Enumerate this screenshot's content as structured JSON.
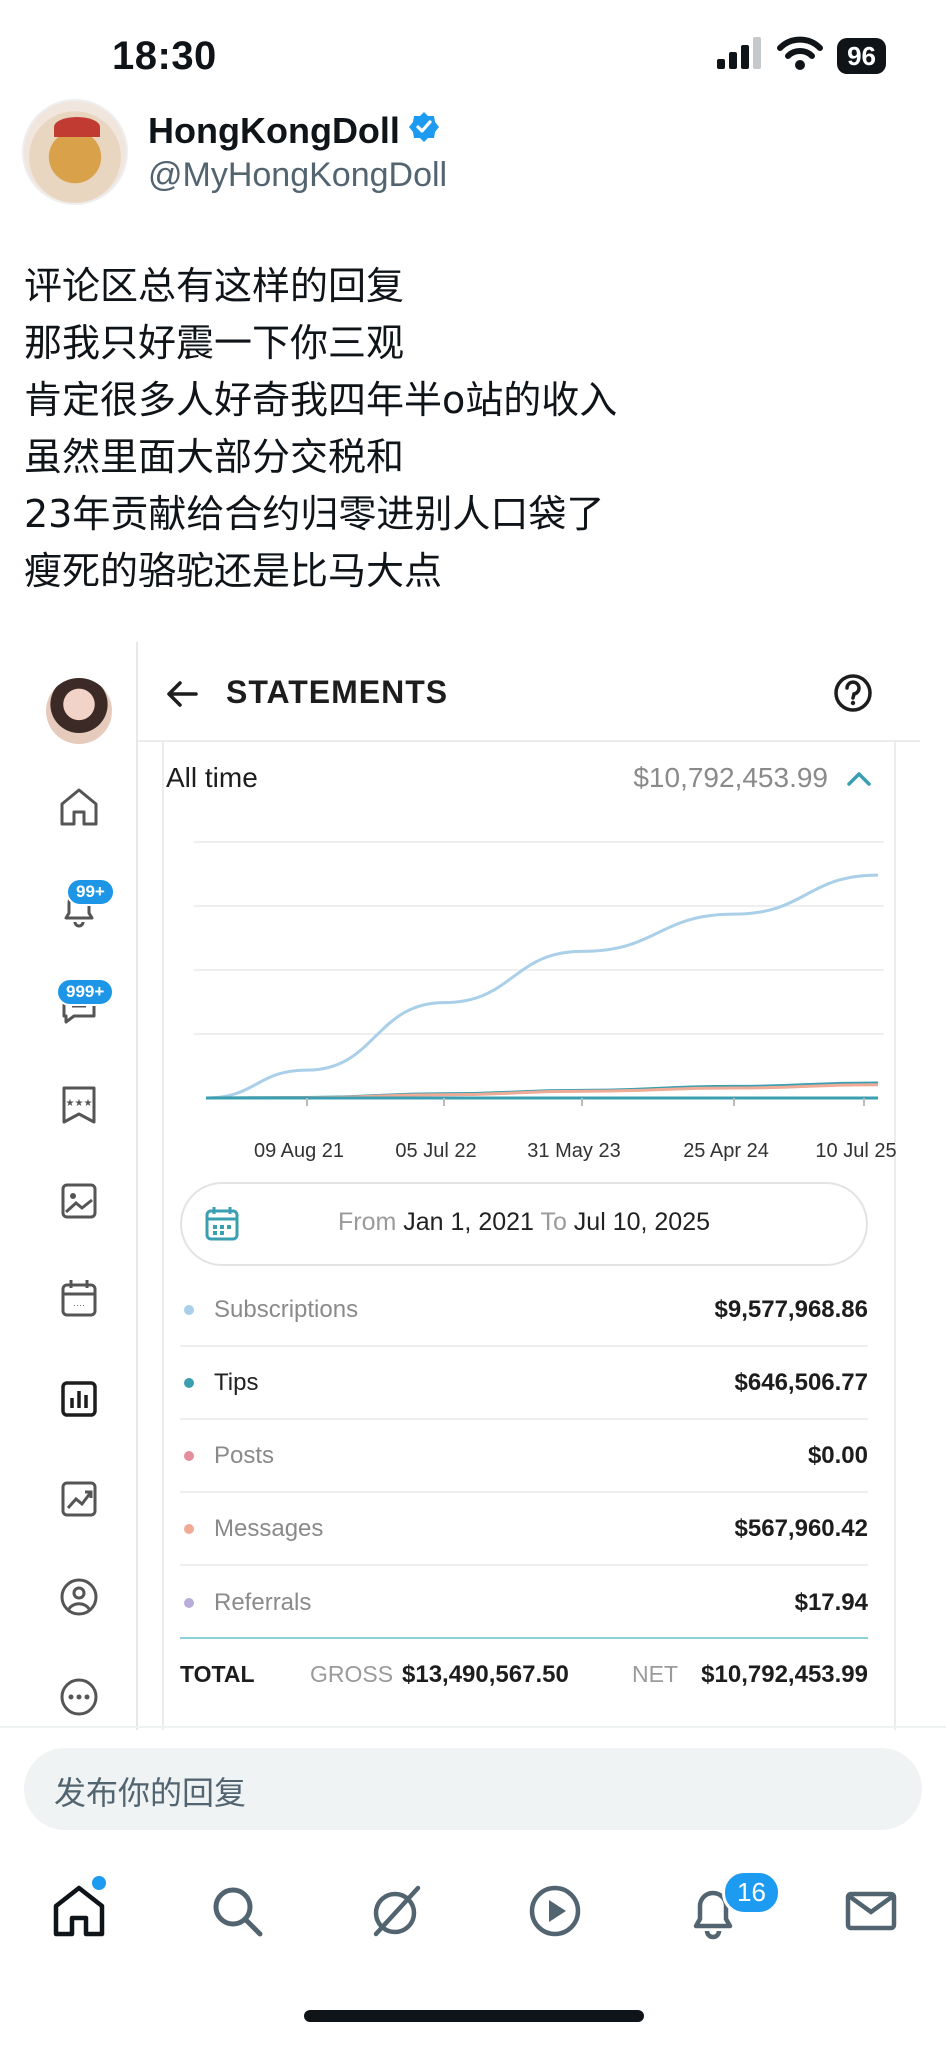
{
  "status_bar": {
    "time": "18:30",
    "battery": "96",
    "icons": [
      "signal-icon",
      "wifi-icon",
      "battery-icon"
    ]
  },
  "tweet": {
    "display_name": "HongKongDoll",
    "handle": "@MyHongKongDoll",
    "verified": true,
    "lines": [
      "评论区总有这样的回复",
      "那我只好震一下你三观",
      "肯定很多人好奇我四年半o站的收入",
      "虽然里面大部分交税和",
      "23年贡献给合约归零进别人口袋了",
      "瘦死的骆驼还是比马大点"
    ]
  },
  "embed": {
    "sidebar": {
      "notifications_badge": "99+",
      "messages_badge": "999+",
      "icons": [
        "home-icon",
        "bell-icon",
        "message-icon",
        "collections-icon",
        "vault-icon",
        "calendar-icon",
        "statistics-icon",
        "analytics-icon",
        "profile-icon",
        "more-icon"
      ]
    },
    "header": {
      "title": "STATEMENTS"
    },
    "period": {
      "label": "All time",
      "amount": "$10,792,453.99"
    },
    "chart_ticks": [
      "09 Aug 21",
      "05 Jul 22",
      "31 May 23",
      "25 Apr 24",
      "10 Jul 25"
    ],
    "range": {
      "from_label": "From",
      "from_value": "Jan 1, 2021",
      "to_label": "To",
      "to_value": "Jul 10, 2025"
    },
    "rows": [
      {
        "label": "Subscriptions",
        "value": "$9,577,968.86",
        "color": "#a9cfe9"
      },
      {
        "label": "Tips",
        "value": "$646,506.77",
        "color": "#3a9fb0"
      },
      {
        "label": "Posts",
        "value": "$0.00",
        "color": "#e58e9b"
      },
      {
        "label": "Messages",
        "value": "$567,960.42",
        "color": "#f0ab97"
      },
      {
        "label": "Referrals",
        "value": "$17.94",
        "color": "#b9addb"
      }
    ],
    "total": {
      "label": "TOTAL",
      "gross_label": "GROSS",
      "gross_value": "$13,490,567.50",
      "net_label": "NET",
      "net_value": "$10,792,453.99"
    }
  },
  "chart_data": {
    "type": "line",
    "x": [
      "09 Aug 21",
      "05 Jul 22",
      "31 May 23",
      "25 Apr 24",
      "10 Jul 25"
    ],
    "series": [
      {
        "name": "Subscriptions",
        "values": [
          1200000,
          4100000,
          6300000,
          7900000,
          9577968.86
        ],
        "color": "#a9cfe9"
      },
      {
        "name": "Tips",
        "values": [
          20000,
          180000,
          330000,
          500000,
          646506.77
        ],
        "color": "#3a9fb0"
      },
      {
        "name": "Messages",
        "values": [
          15000,
          140000,
          290000,
          430000,
          567960.42
        ],
        "color": "#f0ab97"
      },
      {
        "name": "Posts",
        "values": [
          0,
          0,
          0,
          0,
          0
        ],
        "color": "#e58e9b"
      }
    ],
    "title": "",
    "xlabel": "",
    "ylabel": "",
    "grid": true,
    "legend": "none"
  },
  "reply": {
    "placeholder": "发布你的回复"
  },
  "tabbar": {
    "notifications_badge": "16",
    "icons": [
      "home-icon",
      "search-icon",
      "grok-icon",
      "video-icon",
      "notifications-icon",
      "mail-icon"
    ]
  }
}
